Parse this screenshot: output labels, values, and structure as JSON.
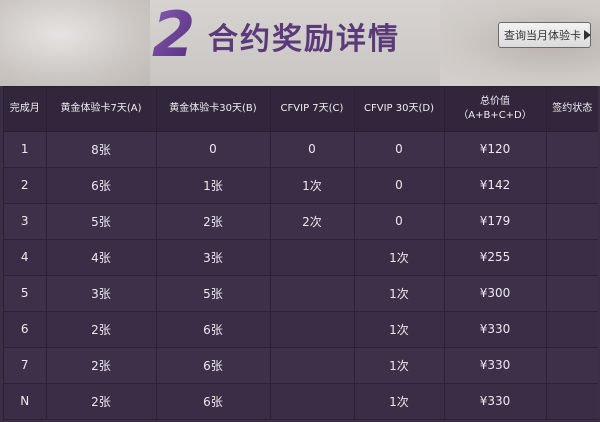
{
  "header": {
    "number": "2",
    "title": "合约奖励详情",
    "query_button": "查询当月体验卡"
  },
  "table": {
    "columns": [
      {
        "label": "完成月",
        "sub": ""
      },
      {
        "label": "黄金体验卡7天(A)",
        "sub": ""
      },
      {
        "label": "黄金体验卡30天(B)",
        "sub": ""
      },
      {
        "label": "CFVIP 7天(C)",
        "sub": ""
      },
      {
        "label": "CFVIP 30天(D)",
        "sub": ""
      },
      {
        "label": "总价值",
        "sub": "（A+B+C+D）"
      },
      {
        "label": "签约状态",
        "sub": ""
      }
    ],
    "rows": [
      [
        "1",
        "8张",
        "0",
        "0",
        "0",
        "¥120",
        ""
      ],
      [
        "2",
        "6张",
        "1张",
        "1次",
        "0",
        "¥142",
        ""
      ],
      [
        "3",
        "5张",
        "2张",
        "2次",
        "0",
        "¥179",
        ""
      ],
      [
        "4",
        "4张",
        "3张",
        "",
        "1次",
        "¥255",
        ""
      ],
      [
        "5",
        "3张",
        "5张",
        "",
        "1次",
        "¥300",
        ""
      ],
      [
        "6",
        "2张",
        "6张",
        "",
        "1次",
        "¥330",
        ""
      ],
      [
        "7",
        "2张",
        "6张",
        "",
        "1次",
        "¥330",
        ""
      ],
      [
        "N",
        "2张",
        "6张",
        "",
        "1次",
        "¥330",
        ""
      ]
    ]
  }
}
